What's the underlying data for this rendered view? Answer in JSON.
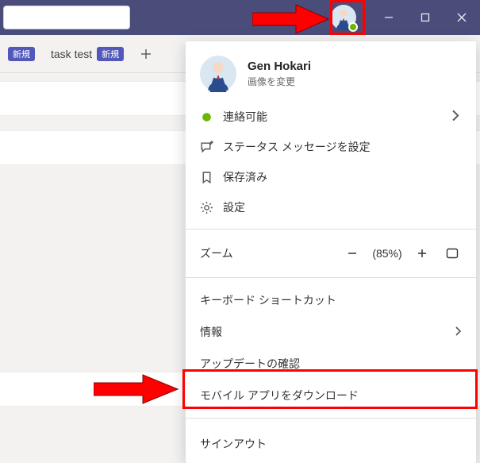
{
  "titlebar": {
    "presence": "available"
  },
  "tabs": {
    "tab0_badge": "新規",
    "tab1_label": "task test",
    "tab1_badge": "新規"
  },
  "menu": {
    "user_name": "Gen Hokari",
    "change_image": "画像を変更",
    "status_label": "連絡可能",
    "set_status_msg": "ステータス メッセージを設定",
    "saved": "保存済み",
    "settings": "設定",
    "zoom_label": "ズーム",
    "zoom_value": "(85%)",
    "keyboard_shortcuts": "キーボード ショートカット",
    "info": "情報",
    "check_updates": "アップデートの確認",
    "download_mobile": "モバイル アプリをダウンロード",
    "signout": "サインアウト"
  }
}
